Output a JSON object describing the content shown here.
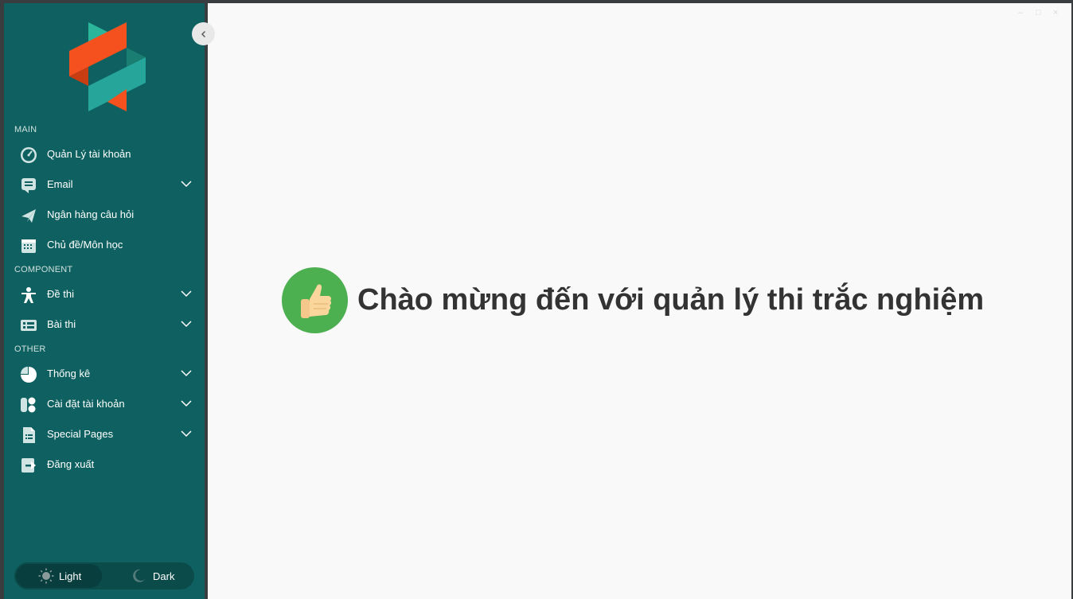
{
  "sidebar": {
    "sections": {
      "main": "MAIN",
      "component": "COMPONENT",
      "other": "OTHER"
    },
    "items": [
      {
        "label": "Quản Lý tài khoản",
        "icon": "dashboard-icon",
        "has_submenu": false
      },
      {
        "label": "Email",
        "icon": "email-icon",
        "has_submenu": true
      },
      {
        "label": "Ngân hàng câu hỏi",
        "icon": "paper-plane-icon",
        "has_submenu": false
      },
      {
        "label": "Chủ đề/Môn học",
        "icon": "calendar-icon",
        "has_submenu": false
      },
      {
        "label": "Đề thi",
        "icon": "person-icon",
        "has_submenu": true
      },
      {
        "label": "Bài thi",
        "icon": "list-icon",
        "has_submenu": true
      },
      {
        "label": "Thống kê",
        "icon": "pie-chart-icon",
        "has_submenu": true
      },
      {
        "label": "Cài đặt tài khoản",
        "icon": "apps-icon",
        "has_submenu": true
      },
      {
        "label": "Special Pages",
        "icon": "document-icon",
        "has_submenu": true
      },
      {
        "label": "Đăng xuất",
        "icon": "logout-icon",
        "has_submenu": false
      }
    ],
    "theme": {
      "light_label": "Light",
      "dark_label": "Dark",
      "selected": "Light"
    }
  },
  "main": {
    "welcome_text": "Chào mừng đến với quản lý thi trắc nghiệm",
    "welcome_icon": "thumbs-up-icon"
  },
  "colors": {
    "sidebar_bg": "#0e6160",
    "main_bg": "#f9f9f9",
    "accent_green": "#4caf50",
    "logo_orange": "#f4511e",
    "logo_teal": "#26a69a"
  }
}
